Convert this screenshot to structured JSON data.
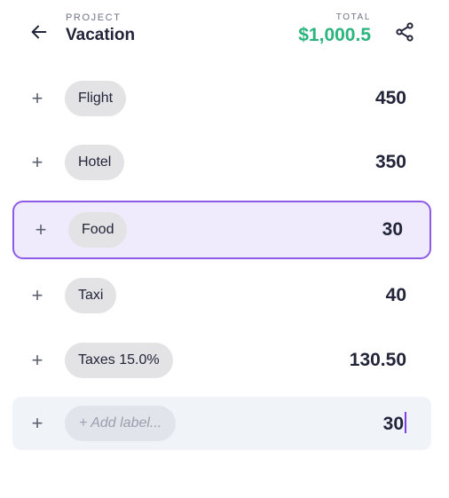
{
  "header": {
    "project_label": "PROJECT",
    "project_name": "Vacation",
    "total_label": "TOTAL",
    "total_value": "$1,000.5",
    "back_icon": "arrow-left-icon",
    "share_icon": "share-icon"
  },
  "items": [
    {
      "label": "Flight",
      "amount": "450"
    },
    {
      "label": "Hotel",
      "amount": "350"
    },
    {
      "label": "Food",
      "amount": "30"
    },
    {
      "label": "Taxi",
      "amount": "40"
    },
    {
      "label": "Taxes 15.0%",
      "amount": "130.50"
    }
  ],
  "new_item": {
    "placeholder": "+ Add label...",
    "amount": "30"
  },
  "colors": {
    "accent": "#8e5ae8",
    "total": "#2bb47e",
    "active_bg": "#efebfd"
  }
}
